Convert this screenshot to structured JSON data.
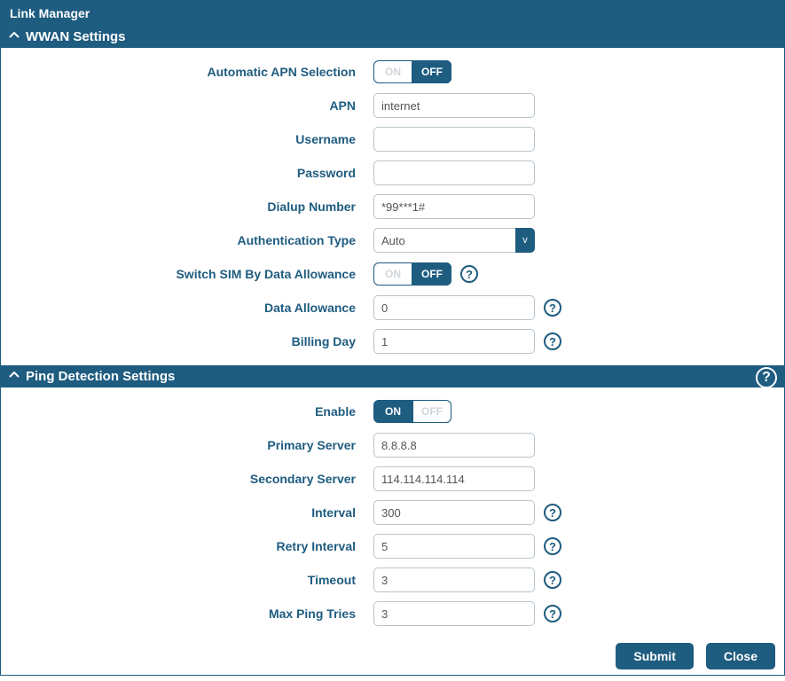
{
  "colors": {
    "primary": "#1e5c80"
  },
  "title": "Link Manager",
  "toggle": {
    "on": "ON",
    "off": "OFF"
  },
  "wwan": {
    "header": "WWAN Settings",
    "auto_apn": {
      "label": "Automatic APN Selection",
      "state": "off"
    },
    "apn": {
      "label": "APN",
      "value": "internet"
    },
    "username": {
      "label": "Username",
      "value": ""
    },
    "password": {
      "label": "Password",
      "value": ""
    },
    "dialup": {
      "label": "Dialup Number",
      "value": "*99***1#"
    },
    "auth_type": {
      "label": "Authentication Type",
      "value": "Auto"
    },
    "switch_sim": {
      "label": "Switch SIM By Data Allowance",
      "state": "off"
    },
    "data_allowance": {
      "label": "Data Allowance",
      "value": "0"
    },
    "billing_day": {
      "label": "Billing Day",
      "value": "1"
    }
  },
  "ping": {
    "header": "Ping Detection Settings",
    "enable": {
      "label": "Enable",
      "state": "on"
    },
    "primary": {
      "label": "Primary Server",
      "value": "8.8.8.8"
    },
    "secondary": {
      "label": "Secondary Server",
      "value": "114.114.114.114"
    },
    "interval": {
      "label": "Interval",
      "value": "300"
    },
    "retry_interval": {
      "label": "Retry Interval",
      "value": "5"
    },
    "timeout": {
      "label": "Timeout",
      "value": "3"
    },
    "max_tries": {
      "label": "Max Ping Tries",
      "value": "3"
    }
  },
  "buttons": {
    "submit": "Submit",
    "close": "Close"
  },
  "icons": {
    "help_glyph": "?",
    "dropdown_glyph": "v"
  }
}
